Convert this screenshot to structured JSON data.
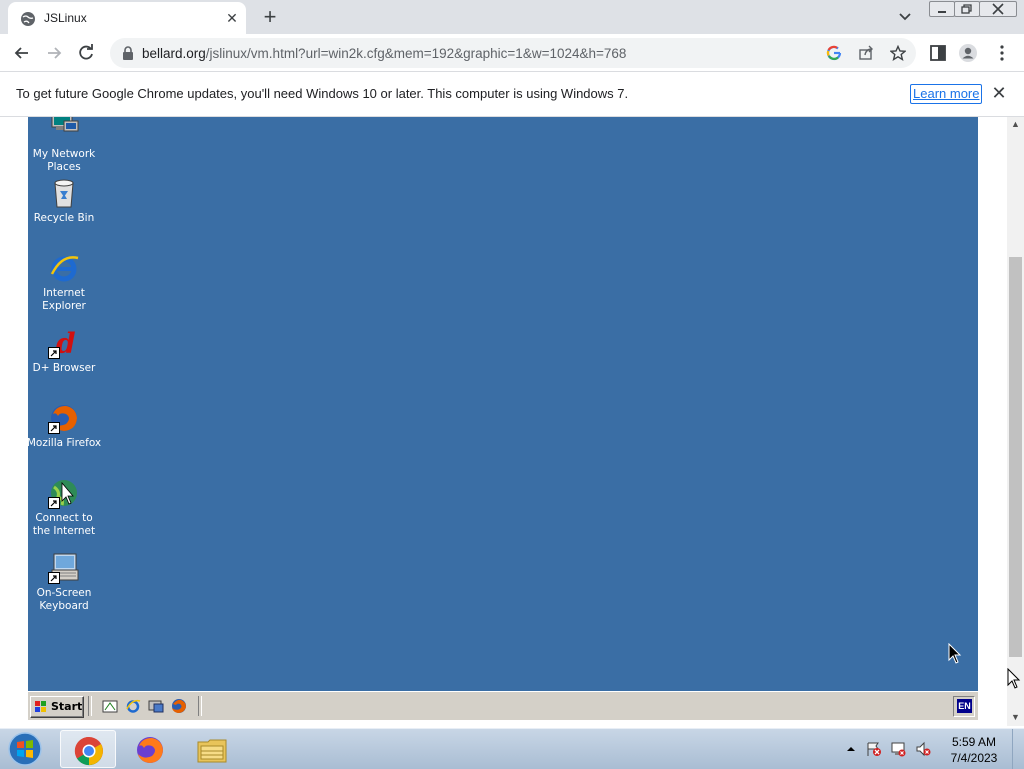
{
  "browser": {
    "tab_title": "JSLinux",
    "url_host": "bellard.org",
    "url_path": "/jslinux/vm.html?url=win2k.cfg&mem=192&graphic=1&w=1024&h=768"
  },
  "infobar": {
    "message": "To get future Google Chrome updates, you'll need Windows 10 or later. This computer is using Windows 7.",
    "learn_more": "Learn more"
  },
  "desktop": {
    "icons": [
      {
        "label_line1": "My Network",
        "label_line2": "Places",
        "icon": "network-places-icon"
      },
      {
        "label_line1": "Recycle Bin",
        "label_line2": "",
        "icon": "recycle-bin-icon"
      },
      {
        "label_line1": "Internet",
        "label_line2": "Explorer",
        "icon": "internet-explorer-icon"
      },
      {
        "label_line1": "D+ Browser",
        "label_line2": "",
        "icon": "dplus-browser-icon"
      },
      {
        "label_line1": "Mozilla Firefox",
        "label_line2": "",
        "icon": "firefox-icon"
      },
      {
        "label_line1": "Connect to",
        "label_line2": "the Internet",
        "icon": "connect-internet-icon"
      },
      {
        "label_line1": "On-Screen",
        "label_line2": "Keyboard",
        "icon": "onscreen-keyboard-icon"
      }
    ],
    "background_color": "#3a6ea5"
  },
  "w2k_taskbar": {
    "start_label": "Start",
    "language": "EN"
  },
  "win7_taskbar": {
    "time": "5:59 AM",
    "date": "7/4/2023"
  }
}
